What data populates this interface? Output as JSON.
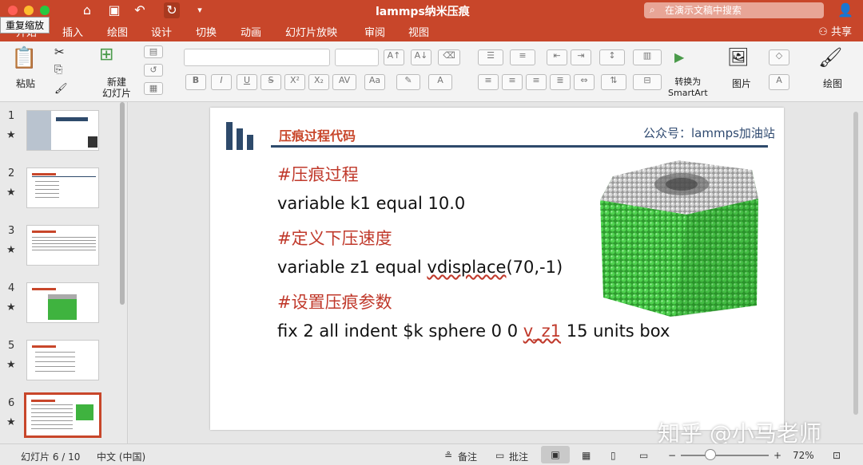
{
  "app": {
    "doc_title": "lammps纳米压痕",
    "search_placeholder": "在演示文稿中搜索",
    "tooltip": "重复缩放",
    "share": "共享",
    "accent": "#c8462a"
  },
  "tabs": [
    "开始",
    "插入",
    "绘图",
    "设计",
    "切换",
    "动画",
    "幻灯片放映",
    "审阅",
    "视图"
  ],
  "ribbon": {
    "paste": "粘贴",
    "new_slide": "新建\n幻灯片",
    "smartart": "转换为\nSmartArt",
    "picture": "图片",
    "draw": "绘图"
  },
  "thumbs": [
    "1",
    "2",
    "3",
    "4",
    "5",
    "6"
  ],
  "slide": {
    "title": "压痕过程代码",
    "right_note": "公众号：lammps加油站",
    "line1": "#压痕过程",
    "line2": "variable k1 equal 10.0",
    "line3": "#定义下压速度",
    "line4_a": "variable z1 equal ",
    "line4_b": "vdisplace",
    "line4_c": "(70,-1)",
    "line5": "#设置压痕参数",
    "line6_a": "fix 2 all indent $k sphere 0 0 ",
    "line6_b": "v_z1",
    "line6_c": " 15 units box"
  },
  "watermark": "知乎 @小马老师",
  "status": {
    "slide_counter": "幻灯片 6 / 10",
    "language": "中文 (中国)",
    "notes": "备注",
    "comments": "批注",
    "zoom": "72%"
  }
}
